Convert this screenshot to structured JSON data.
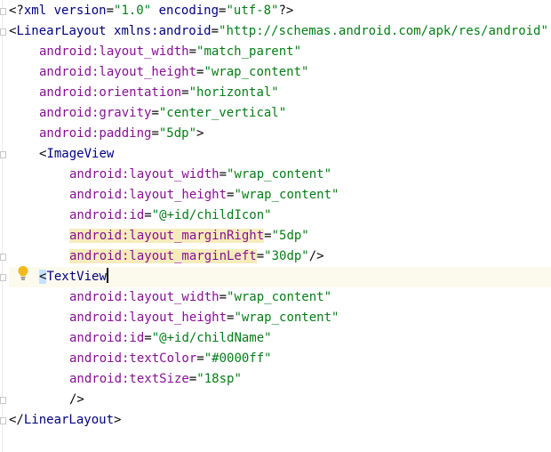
{
  "lines": [
    {
      "parts": [
        {
          "t": "<?",
          "c": "punct"
        },
        {
          "t": "xml version",
          "c": "tag"
        },
        {
          "t": "=",
          "c": "punct"
        },
        {
          "t": "\"1.0\"",
          "c": "attr-val"
        },
        {
          "t": " encoding",
          "c": "tag"
        },
        {
          "t": "=",
          "c": "punct"
        },
        {
          "t": "\"utf-8\"",
          "c": "attr-val"
        },
        {
          "t": "?>",
          "c": "punct"
        }
      ]
    },
    {
      "parts": [
        {
          "t": "<",
          "c": "punct"
        },
        {
          "t": "LinearLayout",
          "c": "tag"
        },
        {
          "t": " xmlns:android",
          "c": "tag"
        },
        {
          "t": "=",
          "c": "punct"
        },
        {
          "t": "\"http://schemas.android.com/apk/res/android\"",
          "c": "attr-val"
        }
      ]
    },
    {
      "parts": [
        {
          "t": "android:layout_width",
          "c": "attr-name"
        },
        {
          "t": "=",
          "c": "punct"
        },
        {
          "t": "\"match_parent\"",
          "c": "attr-val"
        }
      ]
    },
    {
      "parts": [
        {
          "t": "android:layout_height",
          "c": "attr-name"
        },
        {
          "t": "=",
          "c": "punct"
        },
        {
          "t": "\"wrap_content\"",
          "c": "attr-val"
        }
      ]
    },
    {
      "parts": [
        {
          "t": "android:orientation",
          "c": "attr-name"
        },
        {
          "t": "=",
          "c": "punct"
        },
        {
          "t": "\"horizontal\"",
          "c": "attr-val"
        }
      ]
    },
    {
      "parts": [
        {
          "t": "android:gravity",
          "c": "attr-name"
        },
        {
          "t": "=",
          "c": "punct"
        },
        {
          "t": "\"center_vertical\"",
          "c": "attr-val"
        }
      ]
    },
    {
      "parts": [
        {
          "t": "android:padding",
          "c": "attr-name"
        },
        {
          "t": "=",
          "c": "punct"
        },
        {
          "t": "\"5dp\"",
          "c": "attr-val"
        },
        {
          "t": ">",
          "c": "punct"
        }
      ]
    },
    {
      "parts": [
        {
          "t": "<",
          "c": "punct"
        },
        {
          "t": "ImageView",
          "c": "tag"
        }
      ]
    },
    {
      "parts": [
        {
          "t": "android:layout_width",
          "c": "attr-name"
        },
        {
          "t": "=",
          "c": "punct"
        },
        {
          "t": "\"wrap_content\"",
          "c": "attr-val"
        }
      ]
    },
    {
      "parts": [
        {
          "t": "android:layout_height",
          "c": "attr-name"
        },
        {
          "t": "=",
          "c": "punct"
        },
        {
          "t": "\"wrap_content\"",
          "c": "attr-val"
        }
      ]
    },
    {
      "parts": [
        {
          "t": "android:id",
          "c": "attr-name"
        },
        {
          "t": "=",
          "c": "punct"
        },
        {
          "t": "\"@+id/childIcon\"",
          "c": "attr-val"
        }
      ]
    },
    {
      "parts": [
        {
          "t": "android:layout_marginRight",
          "c": "attr-name",
          "hl": "hl-attr"
        },
        {
          "t": "=",
          "c": "punct"
        },
        {
          "t": "\"5dp\"",
          "c": "attr-val"
        }
      ]
    },
    {
      "parts": [
        {
          "t": "android:layout_marginLeft",
          "c": "attr-name",
          "hl": "hl-attr"
        },
        {
          "t": "=",
          "c": "punct"
        },
        {
          "t": "\"30dp\"",
          "c": "attr-val"
        },
        {
          "t": "/>",
          "c": "punct"
        }
      ]
    },
    {
      "parts": [
        {
          "t": "<",
          "c": "punct",
          "hl": "hl-tag"
        },
        {
          "t": "TextView",
          "c": "tag"
        },
        {
          "caret": true
        }
      ]
    },
    {
      "parts": [
        {
          "t": "android:layout_width",
          "c": "attr-name"
        },
        {
          "t": "=",
          "c": "punct"
        },
        {
          "t": "\"wrap_content\"",
          "c": "attr-val"
        }
      ]
    },
    {
      "parts": [
        {
          "t": "android:layout_height",
          "c": "attr-name"
        },
        {
          "t": "=",
          "c": "punct"
        },
        {
          "t": "\"wrap_content\"",
          "c": "attr-val"
        }
      ]
    },
    {
      "parts": [
        {
          "t": "android:id",
          "c": "attr-name"
        },
        {
          "t": "=",
          "c": "punct"
        },
        {
          "t": "\"@+id/childName\"",
          "c": "attr-val"
        }
      ]
    },
    {
      "parts": [
        {
          "t": "android:textColor",
          "c": "attr-name"
        },
        {
          "t": "=",
          "c": "punct"
        },
        {
          "t": "\"#0000ff\"",
          "c": "attr-val"
        }
      ]
    },
    {
      "parts": [
        {
          "t": "android:textSize",
          "c": "attr-name"
        },
        {
          "t": "=",
          "c": "punct"
        },
        {
          "t": "\"18sp\"",
          "c": "attr-val"
        }
      ]
    },
    {
      "parts": [
        {
          "t": "/>",
          "c": "punct"
        }
      ]
    },
    {
      "parts": [
        {
          "t": "</",
          "c": "punct"
        },
        {
          "t": "LinearLayout",
          "c": "tag"
        },
        {
          "t": ">",
          "c": "punct"
        }
      ]
    }
  ],
  "current_line": 13,
  "gutter_icons": {
    "bulb": "lightbulb-intention-icon",
    "fold": "fold-marker-icon"
  },
  "colors": {
    "tag": "#000080",
    "attr": "#871094",
    "value": "#067d17",
    "highlight_attr": "#f6ebbc",
    "highlight_tag": "#c7e1ff",
    "bulb": "#f2b91e"
  }
}
